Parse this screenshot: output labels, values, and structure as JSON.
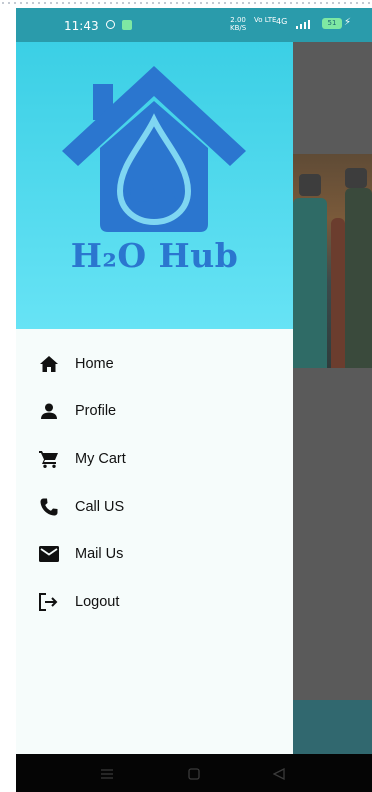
{
  "status_bar": {
    "time": "11:43",
    "speed": "2.00",
    "speed_unit": "KB/S",
    "volte": "Vo LTE",
    "network": "4G",
    "battery": "51"
  },
  "drawer": {
    "brand": "H₂O Hub",
    "menu": [
      {
        "label": "Home",
        "icon": "home-icon"
      },
      {
        "label": "Profile",
        "icon": "person-icon"
      },
      {
        "label": "My Cart",
        "icon": "cart-icon"
      },
      {
        "label": "Call US",
        "icon": "phone-icon"
      },
      {
        "label": "Mail Us",
        "icon": "mail-icon"
      },
      {
        "label": "Logout",
        "icon": "logout-icon"
      }
    ]
  },
  "colors": {
    "header_gradient_top": "#3bcfe5",
    "header_gradient_bottom": "#67e3f5",
    "logo_blue": "#2b76cf",
    "status_bar": "#2a9bab",
    "drawer_bg": "#f6fcfb"
  }
}
